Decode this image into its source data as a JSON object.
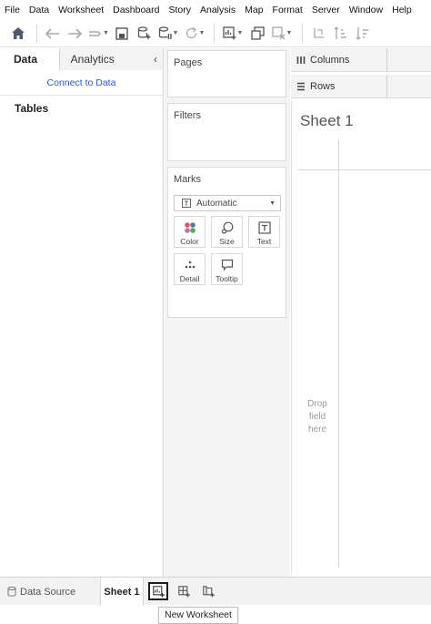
{
  "menu": [
    "File",
    "Data",
    "Worksheet",
    "Dashboard",
    "Story",
    "Analysis",
    "Map",
    "Format",
    "Server",
    "Window",
    "Help"
  ],
  "left_panel": {
    "tabs": {
      "data": "Data",
      "analytics": "Analytics"
    },
    "connect_link": "Connect to Data",
    "tables_label": "Tables"
  },
  "cards": {
    "pages": "Pages",
    "filters": "Filters",
    "marks": {
      "title": "Marks",
      "type_selected": "Automatic",
      "buttons": {
        "color": "Color",
        "size": "Size",
        "text": "Text",
        "detail": "Detail",
        "tooltip": "Tooltip"
      }
    }
  },
  "shelves": {
    "columns": "Columns",
    "rows": "Rows"
  },
  "view": {
    "sheet_title": "Sheet 1",
    "drop_hint": [
      "Drop",
      "field",
      "here"
    ]
  },
  "bottom": {
    "data_source_tab": "Data Source",
    "sheet_tab": "Sheet 1",
    "tooltip": "New Worksheet"
  },
  "colors": {
    "link": "#2b59c3",
    "panel_bg": "#f3f3f3",
    "color_dots": [
      "#e15759",
      "#4e79a7",
      "#b07aa1",
      "#59a14f"
    ]
  }
}
